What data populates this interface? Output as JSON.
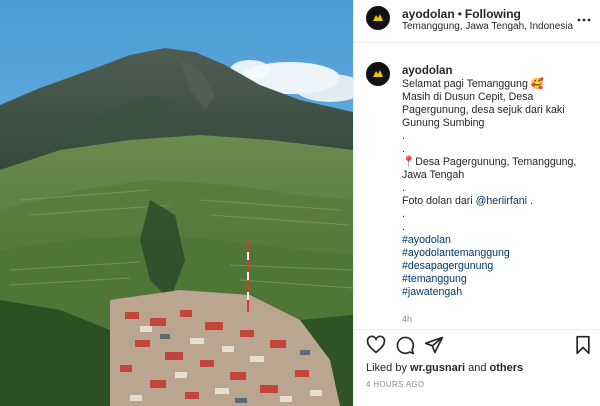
{
  "post": {
    "username": "ayodolan",
    "separator": "•",
    "follow_status": "Following",
    "location": "Temanggung, Jawa Tengah, Indonesia",
    "caption": {
      "username": "ayodolan",
      "lines": [
        "Selamat pagi Temanggung 🥰",
        "Masih di Dusun Cepit, Desa",
        "Pagergunung, desa sejuk dari kaki",
        "Gunung Sumbing",
        ".",
        ".",
        "📍Desa Pagergunung, Temanggung,",
        "Jawa Tengah",
        ".",
        "Foto dolan dari "
      ],
      "mention": "@heriirfani",
      "mention_suffix": " .",
      "dots_after": [
        "."
      ],
      "hashtags": [
        "#ayodolan",
        "#ayodolantemanggung",
        "#desapagergunung",
        "#temanggung",
        "#jawatengah"
      ],
      "time": "4h"
    },
    "likes": {
      "prefix": "Liked by ",
      "user": "wr.gusnari",
      "middle": " and ",
      "others": "others"
    },
    "age": "4 HOURS AGO",
    "icons": {
      "more": "more-options-icon",
      "like": "heart-icon",
      "comment": "comment-icon",
      "share": "paper-plane-icon",
      "save": "bookmark-icon"
    },
    "colors": {
      "text": "#262626",
      "muted": "#8e8e8e",
      "link": "#00376b",
      "border": "#efefef"
    }
  }
}
